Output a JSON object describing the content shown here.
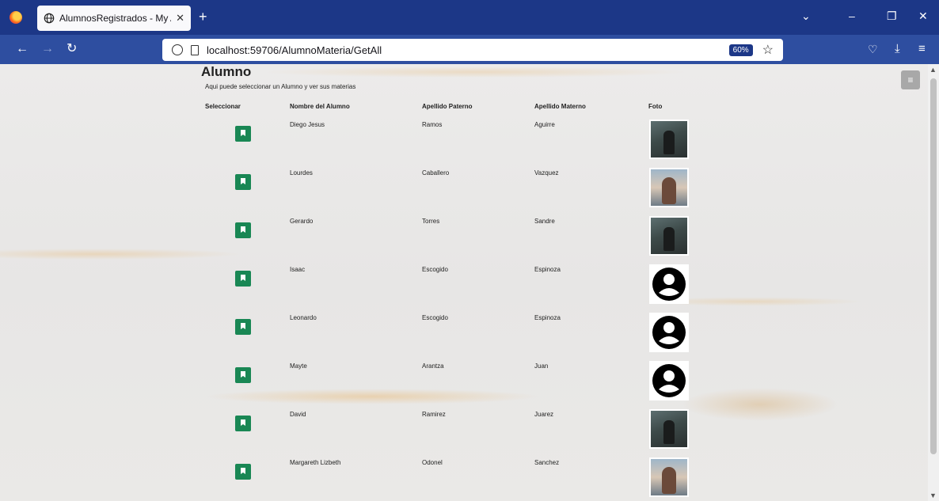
{
  "browser": {
    "tab_title": "AlumnosRegistrados - My ASP.N",
    "url": "localhost:59706/AlumnoMateria/GetAll",
    "zoom": "60%"
  },
  "page": {
    "heading": "Alumno",
    "subtitle": "Aqui puede seleccionar un Alumno y ver sus materias",
    "columns": [
      "Seleccionar",
      "Nombre del Alumno",
      "Apellido Paterno",
      "Apellido Materno",
      "Foto"
    ]
  },
  "rows": [
    {
      "nombre": "Diego Jesus",
      "paterno": "Ramos",
      "materno": "Aguirre",
      "foto": "man-photo"
    },
    {
      "nombre": "Lourdes",
      "paterno": "Caballero",
      "materno": "Vazquez",
      "foto": "woman-photo"
    },
    {
      "nombre": "Gerardo",
      "paterno": "Torres",
      "materno": "Sandre",
      "foto": "man-photo"
    },
    {
      "nombre": "Isaac",
      "paterno": "Escogido",
      "materno": "Espinoza",
      "foto": "default-avatar"
    },
    {
      "nombre": "Leonardo",
      "paterno": "Escogido",
      "materno": "Espinoza",
      "foto": "default-avatar"
    },
    {
      "nombre": "Mayte",
      "paterno": "Arantza",
      "materno": "Juan",
      "foto": "default-avatar"
    },
    {
      "nombre": "David",
      "paterno": "Ramirez",
      "materno": "Juarez",
      "foto": "man-photo"
    },
    {
      "nombre": "Margareth Lizbeth",
      "paterno": "Odonel",
      "materno": "Sanchez",
      "foto": "woman-photo"
    }
  ],
  "colors": {
    "select_button": "#198754",
    "toolbar": "#1c3787"
  }
}
